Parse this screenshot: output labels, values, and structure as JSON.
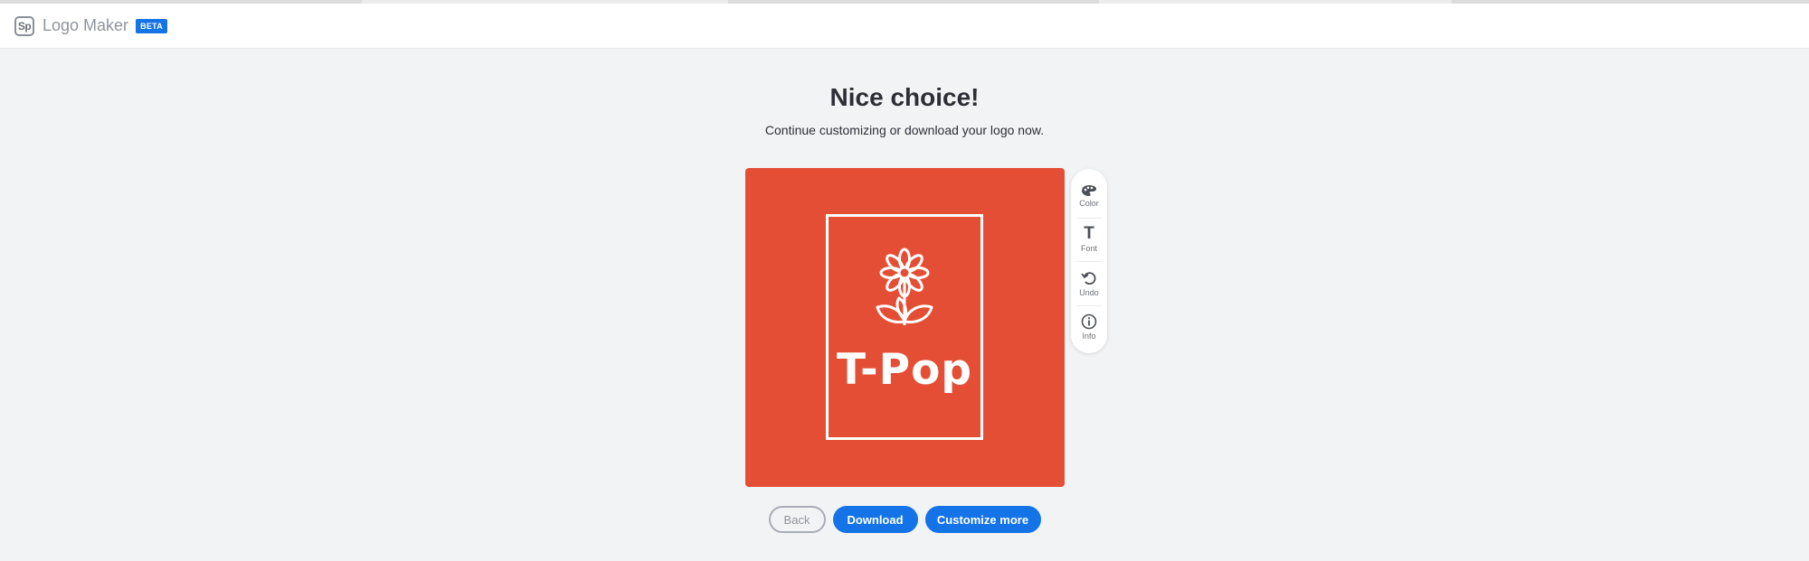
{
  "header": {
    "logo_letters": "Sp",
    "app_name": "Logo Maker",
    "badge": "BETA"
  },
  "main": {
    "title": "Nice choice!",
    "subtitle": "Continue customizing or download your logo now."
  },
  "logo_preview": {
    "text": "T-Pop",
    "background_color": "#e44e35",
    "foreground_color": "#ffffff",
    "icon": "flower-icon"
  },
  "toolbar": {
    "items": [
      {
        "label": "Color",
        "icon": "palette-icon"
      },
      {
        "label": "Font",
        "icon": "font-icon"
      },
      {
        "label": "Undo",
        "icon": "undo-icon"
      },
      {
        "label": "Info",
        "icon": "info-icon"
      }
    ]
  },
  "actions": {
    "back": "Back",
    "download": "Download",
    "customize": "Customize more"
  },
  "colors": {
    "accent": "#1473e6",
    "background": "#f2f3f5"
  }
}
